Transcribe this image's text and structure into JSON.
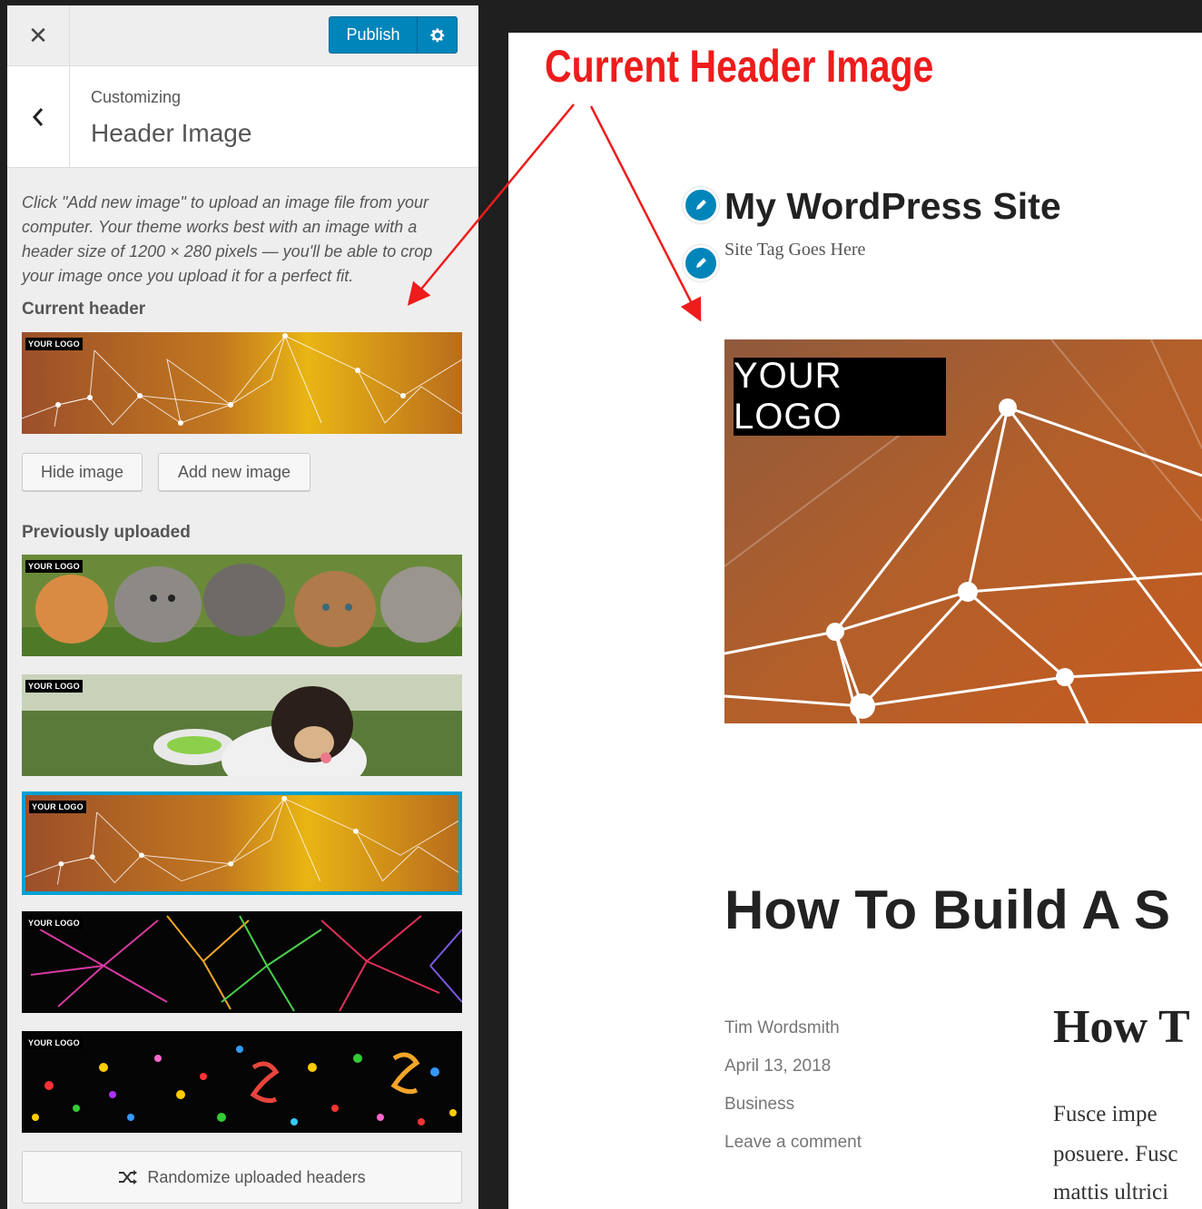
{
  "topbar": {
    "close_icon": "close-icon",
    "publish_label": "Publish",
    "gear_icon": "gear-icon"
  },
  "section": {
    "breadcrumb": "Customizing",
    "title": "Header Image"
  },
  "description": "Click \"Add new image\" to upload an image file from your computer. Your theme works best with an image with a header size of 1200 × 280 pixels — you'll be able to crop your image once you upload it for a perfect fit.",
  "current": {
    "label": "Current header",
    "logo_text": "YOUR LOGO",
    "hide_button": "Hide image",
    "add_button": "Add new image"
  },
  "previous": {
    "label": "Previously uploaded",
    "items": [
      {
        "logo_text": "YOUR LOGO",
        "theme": "kittens"
      },
      {
        "logo_text": "YOUR LOGO",
        "theme": "puppy"
      },
      {
        "logo_text": "YOUR LOGO",
        "theme": "orange-network",
        "selected": true
      },
      {
        "logo_text": "YOUR LOGO",
        "theme": "fireworks"
      },
      {
        "logo_text": "YOUR LOGO",
        "theme": "confetti"
      }
    ],
    "randomize_label": "Randomize uploaded headers"
  },
  "annotation": {
    "text": "Current Header Image",
    "color": "#ee1c1c"
  },
  "preview": {
    "site_title": "My WordPress Site",
    "tagline": "Site Tag Goes Here",
    "hero_logo": "YOUR LOGO",
    "post_title": "How To Build A S",
    "meta": {
      "author": "Tim Wordsmith",
      "date": "April 13, 2018",
      "category": "Business",
      "comment": "Leave a comment"
    },
    "second_title": "How T",
    "excerpt_lines": [
      "Fusce  impe",
      "posuere. Fusc",
      "mattis ultrici"
    ]
  },
  "colors": {
    "accent": "#0085ba",
    "sidebar_bg": "#eeeeee",
    "frame": "#1f1f1f"
  }
}
